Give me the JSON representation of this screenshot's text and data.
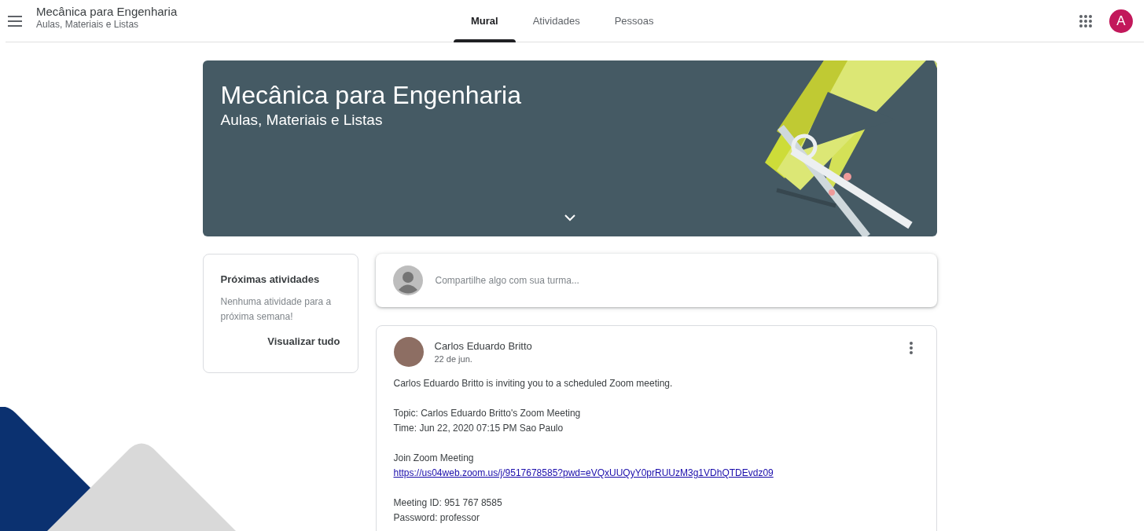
{
  "header": {
    "title": "Mecânica para Engenharia",
    "subtitle": "Aulas, Materiais e Listas",
    "avatar_letter": "A"
  },
  "tabs": [
    {
      "label": "Mural",
      "selected": true
    },
    {
      "label": "Atividades",
      "selected": false
    },
    {
      "label": "Pessoas",
      "selected": false
    }
  ],
  "banner": {
    "title": "Mecânica para Engenharia",
    "subtitle": "Aulas, Materiais e Listas"
  },
  "upcoming": {
    "title": "Próximas atividades",
    "message": "Nenhuma atividade para a próxima semana!",
    "link": "Visualizar tudo"
  },
  "share": {
    "placeholder": "Compartilhe algo com sua turma..."
  },
  "post": {
    "author": "Carlos Eduardo Britto",
    "date": "22 de jun.",
    "paragraphs": [
      [
        {
          "kind": "text",
          "text": "Carlos Eduardo Britto is inviting you to a scheduled Zoom meeting."
        }
      ],
      [
        {
          "kind": "text",
          "text": "Topic: Carlos Eduardo Britto's Zoom Meeting"
        },
        {
          "kind": "text",
          "text": "Time: Jun 22, 2020 07:15 PM Sao Paulo"
        }
      ],
      [
        {
          "kind": "text",
          "text": "Join Zoom Meeting"
        },
        {
          "kind": "link",
          "text": "https://us04web.zoom.us/j/9517678585?pwd=eVQxUUQyY0prRUUzM3g1VDhQTDEvdz09"
        }
      ],
      [
        {
          "kind": "text",
          "text": "Meeting ID: 951 767 8585"
        },
        {
          "kind": "text",
          "text": "Password: professor"
        }
      ]
    ]
  }
}
